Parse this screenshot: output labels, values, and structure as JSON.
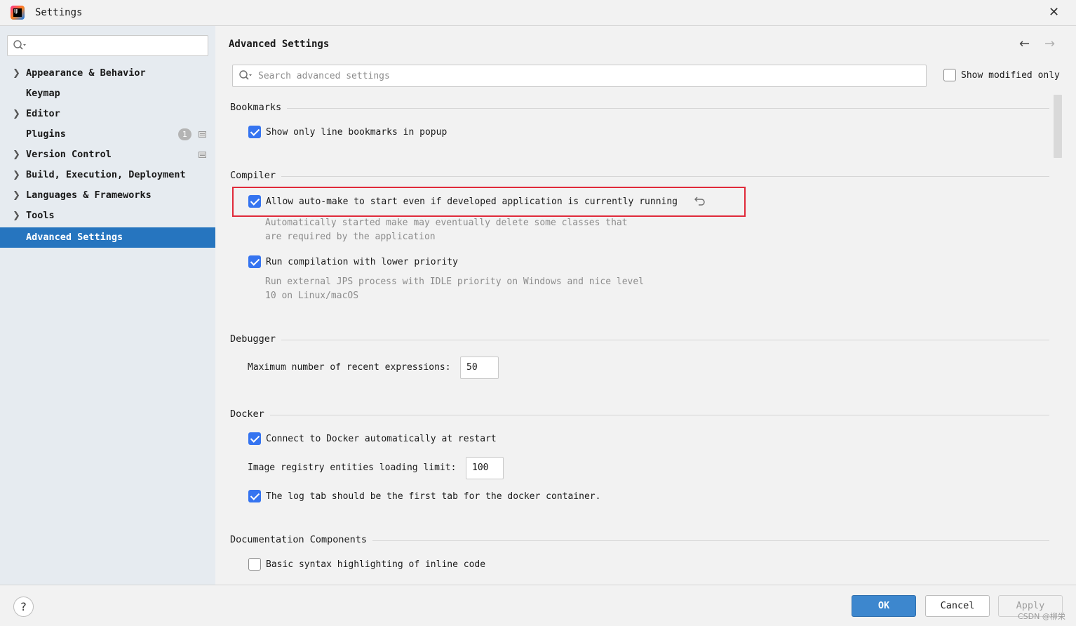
{
  "window": {
    "title": "Settings",
    "app_icon": "intellij-idea-icon",
    "close_icon": "✕"
  },
  "sidebar": {
    "search_placeholder": "",
    "items": [
      {
        "label": "Appearance & Behavior",
        "expandable": true
      },
      {
        "label": "Keymap",
        "expandable": false
      },
      {
        "label": "Editor",
        "expandable": true
      },
      {
        "label": "Plugins",
        "expandable": false,
        "badge": "1"
      },
      {
        "label": "Version Control",
        "expandable": true
      },
      {
        "label": "Build, Execution, Deployment",
        "expandable": true
      },
      {
        "label": "Languages & Frameworks",
        "expandable": true
      },
      {
        "label": "Tools",
        "expandable": true
      },
      {
        "label": "Advanced Settings",
        "expandable": false,
        "selected": true
      }
    ]
  },
  "main": {
    "title": "Advanced Settings",
    "back_icon": "←",
    "forward_icon": "→",
    "search_placeholder": "Search advanced settings",
    "show_modified_label": "Show modified only",
    "sections": {
      "bookmarks": {
        "title": "Bookmarks",
        "option1": "Show only line bookmarks in popup"
      },
      "compiler": {
        "title": "Compiler",
        "option1": "Allow auto-make to start even if developed application is currently running",
        "option1_hint1": "Automatically started make may eventually delete some classes that",
        "option1_hint2": "are required by the application",
        "option2": "Run compilation with lower priority",
        "option2_hint1": "Run external JPS process with IDLE priority on Windows and nice level",
        "option2_hint2": "10 on Linux/macOS"
      },
      "debugger": {
        "title": "Debugger",
        "field_label": "Maximum number of recent expressions:",
        "field_value": "50"
      },
      "docker": {
        "title": "Docker",
        "option1": "Connect to Docker automatically at restart",
        "field_label": "Image registry entities loading limit:",
        "field_value": "100",
        "option2": "The log tab should be the first tab for the docker container."
      },
      "documentation": {
        "title": "Documentation Components",
        "option1": "Basic syntax highlighting of inline code"
      }
    }
  },
  "footer": {
    "help": "?",
    "ok": "OK",
    "cancel": "Cancel",
    "apply": "Apply",
    "watermark": "CSDN @柳栄"
  },
  "colors": {
    "accent": "#3574f0",
    "selection": "#2675bf",
    "highlight_border": "#e02a3a"
  }
}
